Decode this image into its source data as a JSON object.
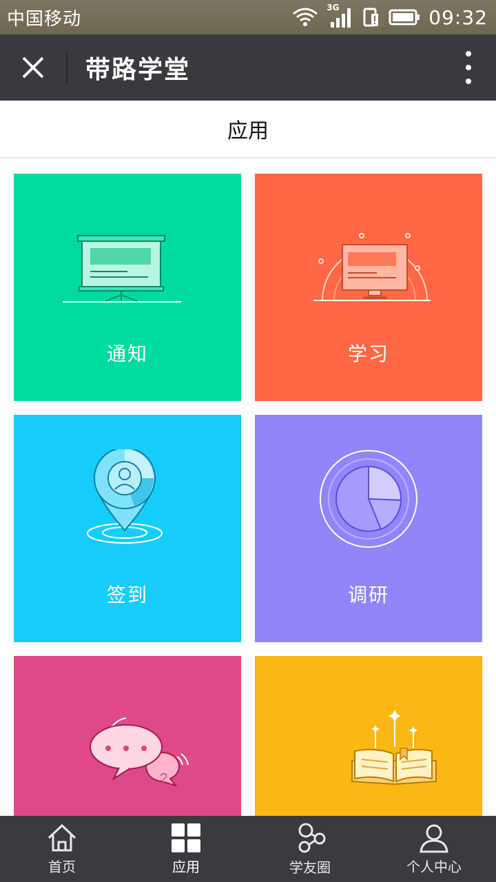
{
  "status_bar": {
    "carrier": "中国移动",
    "network": "3G",
    "time": "09:32"
  },
  "title_bar": {
    "title": "带路学堂",
    "close_icon": "close-icon",
    "more_icon": "more-vertical-icon",
    "background": "#393a3f"
  },
  "page": {
    "title": "应用"
  },
  "tiles": [
    {
      "label": "通知",
      "color": "#00dba0",
      "icon": "presentation-board-icon"
    },
    {
      "label": "学习",
      "color": "#ff6845",
      "icon": "monitor-icon"
    },
    {
      "label": "签到",
      "color": "#16cdfa",
      "icon": "location-pin-icon"
    },
    {
      "label": "调研",
      "color": "#9185fb",
      "icon": "pie-chart-icon"
    },
    {
      "label": "",
      "color": "#de4a87",
      "icon": "chat-bubbles-icon"
    },
    {
      "label": "",
      "color": "#fbb714",
      "icon": "open-book-icon"
    }
  ],
  "tab_bar": {
    "tabs": [
      {
        "label": "首页",
        "icon": "home-icon"
      },
      {
        "label": "应用",
        "icon": "apps-grid-icon"
      },
      {
        "label": "学友圈",
        "icon": "friends-circle-icon"
      },
      {
        "label": "个人中心",
        "icon": "user-icon"
      }
    ],
    "active_index": 1
  }
}
